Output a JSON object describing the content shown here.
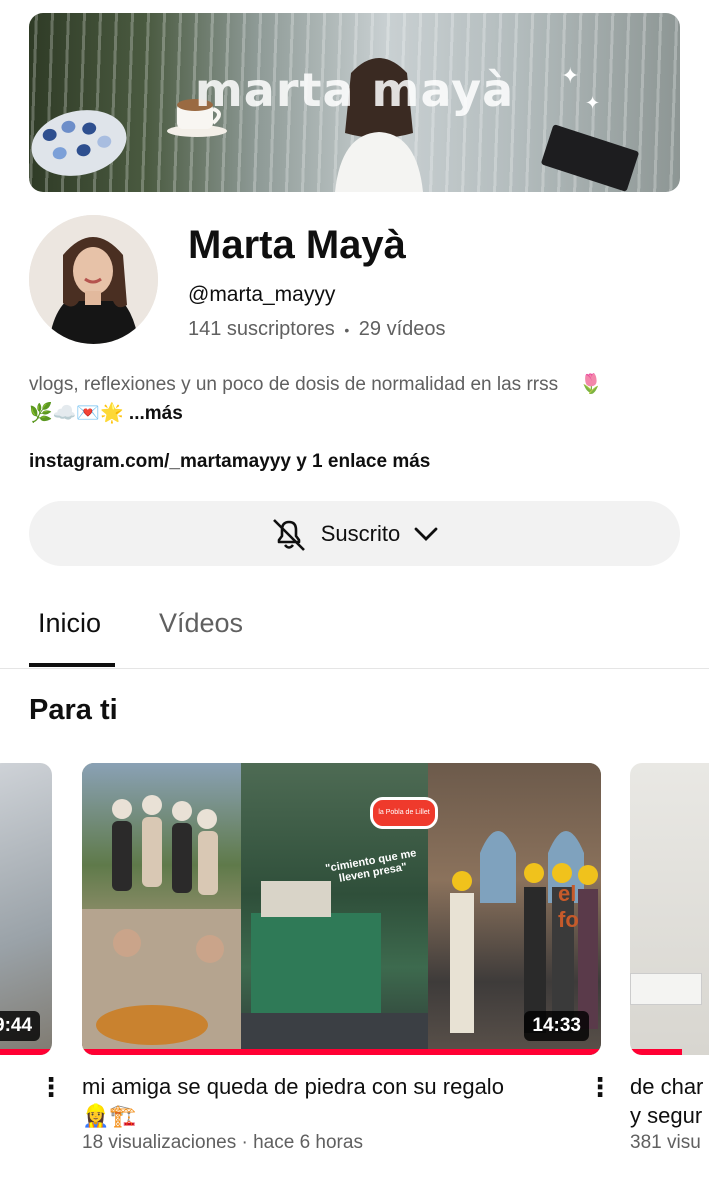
{
  "banner": {
    "title": "marta mayà"
  },
  "channel": {
    "name": "Marta Mayà",
    "handle": "@marta_mayyy",
    "subscribers": "141 suscriptores",
    "separator": "•",
    "videos": "29 vídeos",
    "description": "vlogs, reflexiones y un poco de dosis de normalidad en las rrss",
    "description_emoji": "🌷",
    "description_line2_emoji": "🌿☁️💌🌟",
    "more": "...más",
    "link": "instagram.com/_martamayyy",
    "link_more": " y 1 enlace más"
  },
  "subscribe_button": {
    "label": "Suscrito",
    "icon": "bell-off-icon"
  },
  "tabs": [
    {
      "label": "Inicio",
      "active": true
    },
    {
      "label": "Vídeos",
      "active": false
    }
  ],
  "section": {
    "title": "Para ti"
  },
  "videos": [
    {
      "duration": "9:44"
    },
    {
      "duration": "14:33",
      "title": "mi amiga se queda de piedra con su regalo",
      "title_emoji": "👷‍♀️🏗️",
      "views": "18 visualizaciones",
      "age": "hace 6 horas",
      "overlay_text": "\"cimiento que me lleven presa\"",
      "sign_text": "la Pobla de Lillet",
      "wall_text": "el fo"
    },
    {
      "title_line1": "de char",
      "title_line2": "y segur",
      "views": "381 visu"
    }
  ],
  "colors": {
    "progress": "#ff0033",
    "button_bg": "#f2f2f2",
    "secondary_text": "#606060"
  }
}
